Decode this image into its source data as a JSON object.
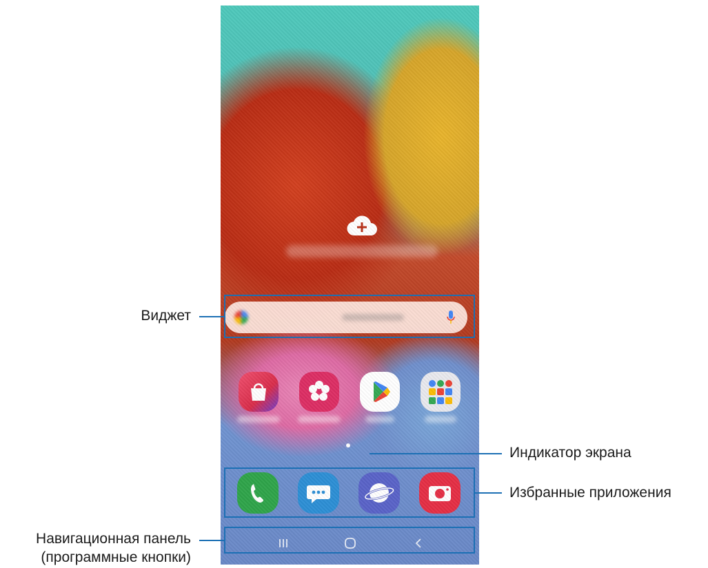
{
  "callouts": {
    "widget": "Виджет",
    "screen_indicator": "Индикатор экрана",
    "favorite_apps": "Избранные приложения",
    "navigation_bar_line1": "Навигационная панель",
    "navigation_bar_line2": "(программные кнопки)"
  },
  "home_screen": {
    "add_widget_icon": "cloud-plus-icon",
    "search_widget": {
      "logo_icon": "google-g-icon",
      "mic_icon": "microphone-icon"
    },
    "apps": [
      {
        "icon": "galaxy-store-icon",
        "color": "#e8364c"
      },
      {
        "icon": "gallery-flower-icon",
        "color": "#dd2e64"
      },
      {
        "icon": "play-store-icon",
        "color": "#ffffff"
      },
      {
        "icon": "google-folder-icon",
        "color": "#e9e9ee"
      }
    ],
    "dock": [
      {
        "icon": "phone-icon",
        "color": "#2fa44a"
      },
      {
        "icon": "messages-icon",
        "color": "#2d8fd5"
      },
      {
        "icon": "internet-icon",
        "color": "#5a63c8"
      },
      {
        "icon": "camera-icon",
        "color": "#e52f45"
      }
    ],
    "navigation": [
      "recent-apps-icon",
      "home-icon",
      "back-icon"
    ]
  },
  "accent_color": "#1b6fb4"
}
